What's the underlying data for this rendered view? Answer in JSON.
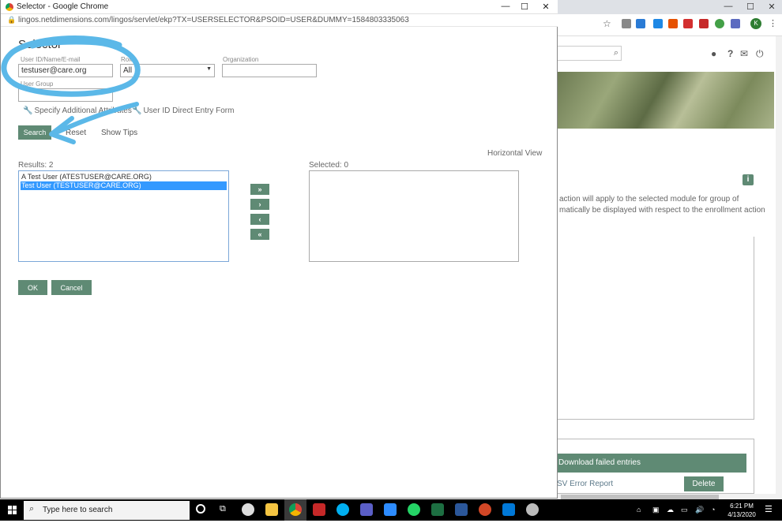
{
  "popup": {
    "title": "Selector - Google Chrome",
    "url": "lingos.netdimensions.com/lingos/servlet/ekp?TX=USERSELECTOR&PSOID=USER&DUMMY=1584803335063",
    "heading": "Selector",
    "fields": {
      "user_label": "User ID/Name/E-mail",
      "user_value": "testuser@care.org",
      "role_label": "Role",
      "role_value": "All",
      "org_label": "Organization",
      "org_value": "",
      "group_label": "User Group",
      "group_value": ""
    },
    "links": {
      "additional": "Specify Additional Attributes",
      "direct_entry": "User ID Direct Entry Form"
    },
    "buttons": {
      "search": "Search",
      "reset": "Reset",
      "show_tips": "Show Tips",
      "ok": "OK",
      "cancel": "Cancel"
    },
    "horizontal_view": "Horizontal View",
    "results_label": "Results: 2",
    "selected_label": "Selected: 0",
    "results": [
      {
        "text": "A Test User (ATESTUSER@CARE.ORG)",
        "selected": false
      },
      {
        "text": "Test User (TESTUSER@CARE.ORG)",
        "selected": true
      }
    ],
    "arrows": [
      "»",
      "›",
      "‹",
      "«"
    ]
  },
  "background": {
    "info_text_1": "action will apply to the selected module for group of",
    "info_text_2": "matically be displayed with respect to the enrollment action",
    "download_bar": "Download failed entries",
    "csv_text": "SV Error Report",
    "delete_button": "Delete",
    "profile_letter": "K"
  },
  "taskbar": {
    "search_placeholder": "Type here to search",
    "time": "6:21 PM",
    "date": "4/13/2020"
  },
  "colors": {
    "accent": "#5f8a74",
    "selection": "#3399ff",
    "annotation": "#5bb8e8"
  }
}
